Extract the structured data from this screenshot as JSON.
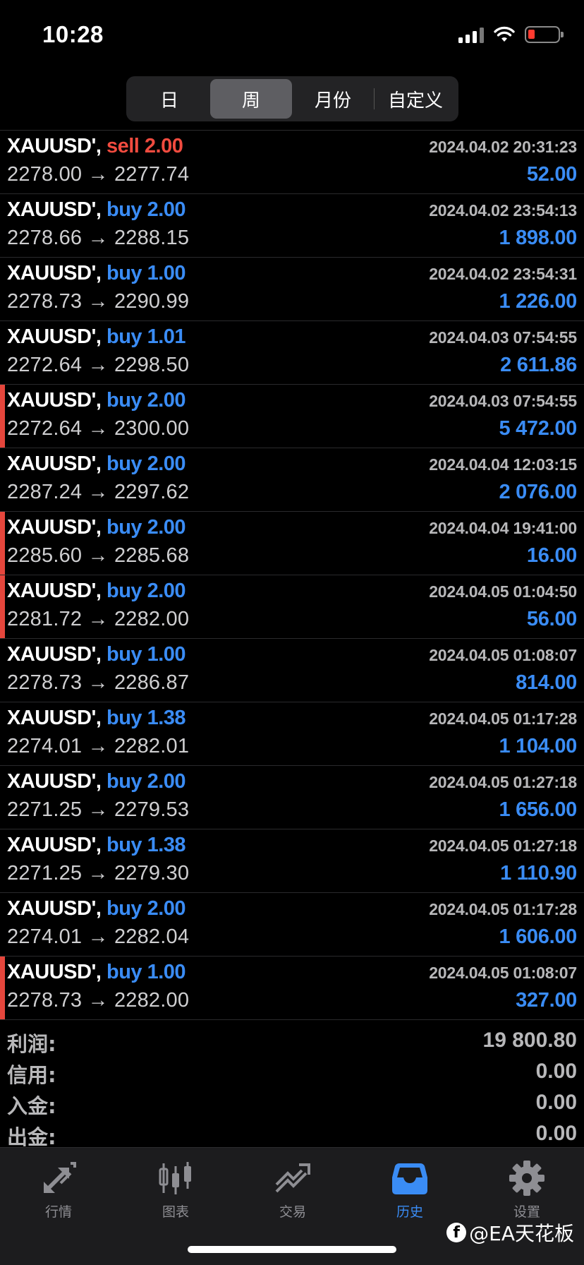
{
  "status_bar": {
    "time": "10:28"
  },
  "segments": [
    {
      "label": "日",
      "active": false
    },
    {
      "label": "周",
      "active": true
    },
    {
      "label": "月份",
      "active": false
    },
    {
      "label": "自定义",
      "active": false
    }
  ],
  "trades": [
    {
      "symbol": "XAUUSD',",
      "type": "sell",
      "volume": "2.00",
      "datetime": "2024.04.02 20:31:23",
      "prices": "2278.00 → 2277.74",
      "profit": "52.00",
      "marked": false
    },
    {
      "symbol": "XAUUSD',",
      "type": "buy",
      "volume": "2.00",
      "datetime": "2024.04.02 23:54:13",
      "prices": "2278.66 → 2288.15",
      "profit": "1 898.00",
      "marked": false
    },
    {
      "symbol": "XAUUSD',",
      "type": "buy",
      "volume": "1.00",
      "datetime": "2024.04.02 23:54:31",
      "prices": "2278.73 → 2290.99",
      "profit": "1 226.00",
      "marked": false
    },
    {
      "symbol": "XAUUSD',",
      "type": "buy",
      "volume": "1.01",
      "datetime": "2024.04.03 07:54:55",
      "prices": "2272.64 → 2298.50",
      "profit": "2 611.86",
      "marked": false
    },
    {
      "symbol": "XAUUSD',",
      "type": "buy",
      "volume": "2.00",
      "datetime": "2024.04.03 07:54:55",
      "prices": "2272.64 → 2300.00",
      "profit": "5 472.00",
      "marked": true
    },
    {
      "symbol": "XAUUSD',",
      "type": "buy",
      "volume": "2.00",
      "datetime": "2024.04.04 12:03:15",
      "prices": "2287.24 → 2297.62",
      "profit": "2 076.00",
      "marked": false
    },
    {
      "symbol": "XAUUSD',",
      "type": "buy",
      "volume": "2.00",
      "datetime": "2024.04.04 19:41:00",
      "prices": "2285.60 → 2285.68",
      "profit": "16.00",
      "marked": true
    },
    {
      "symbol": "XAUUSD',",
      "type": "buy",
      "volume": "2.00",
      "datetime": "2024.04.05 01:04:50",
      "prices": "2281.72 → 2282.00",
      "profit": "56.00",
      "marked": true
    },
    {
      "symbol": "XAUUSD',",
      "type": "buy",
      "volume": "1.00",
      "datetime": "2024.04.05 01:08:07",
      "prices": "2278.73 → 2286.87",
      "profit": "814.00",
      "marked": false
    },
    {
      "symbol": "XAUUSD',",
      "type": "buy",
      "volume": "1.38",
      "datetime": "2024.04.05 01:17:28",
      "prices": "2274.01 → 2282.01",
      "profit": "1 104.00",
      "marked": false
    },
    {
      "symbol": "XAUUSD',",
      "type": "buy",
      "volume": "2.00",
      "datetime": "2024.04.05 01:27:18",
      "prices": "2271.25 → 2279.53",
      "profit": "1 656.00",
      "marked": false
    },
    {
      "symbol": "XAUUSD',",
      "type": "buy",
      "volume": "1.38",
      "datetime": "2024.04.05 01:27:18",
      "prices": "2271.25 → 2279.30",
      "profit": "1 110.90",
      "marked": false
    },
    {
      "symbol": "XAUUSD',",
      "type": "buy",
      "volume": "2.00",
      "datetime": "2024.04.05 01:17:28",
      "prices": "2274.01 → 2282.04",
      "profit": "1 606.00",
      "marked": false
    },
    {
      "symbol": "XAUUSD',",
      "type": "buy",
      "volume": "1.00",
      "datetime": "2024.04.05 01:08:07",
      "prices": "2278.73 → 2282.00",
      "profit": "327.00",
      "marked": true
    }
  ],
  "summary": {
    "profit_label": "利润:",
    "profit_value": "19 800.80",
    "credit_label": "信用:",
    "credit_value": "0.00",
    "deposit_label": "入金:",
    "deposit_value": "0.00",
    "withdrawal_label": "出金:",
    "withdrawal_value": "0.00"
  },
  "tabbar": [
    {
      "label": "行情",
      "icon": "quotes-icon",
      "active": false
    },
    {
      "label": "图表",
      "icon": "candlestick-chart-icon",
      "active": false
    },
    {
      "label": "交易",
      "icon": "trade-icon",
      "active": false
    },
    {
      "label": "历史",
      "icon": "history-inbox-icon",
      "active": true
    },
    {
      "label": "设置",
      "icon": "gear-icon",
      "active": false
    }
  ],
  "watermark": {
    "text": "@EA天花板"
  },
  "colors": {
    "buy": "#3a8cf5",
    "sell": "#f14b3f",
    "marker": "#e5463c",
    "active_tab": "#3a8cf5"
  }
}
